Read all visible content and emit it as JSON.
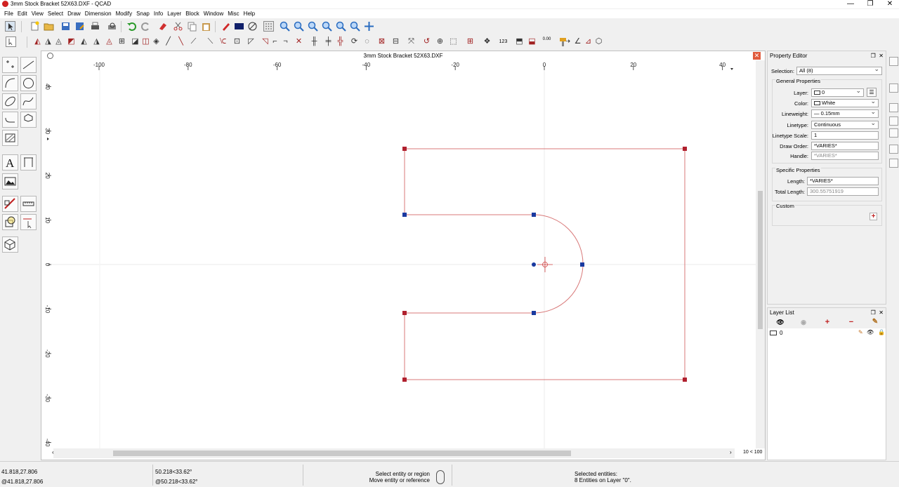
{
  "window": {
    "title": "3mm Stock Bracket 52X63.DXF - QCAD",
    "minimize": "—",
    "maximize": "❐",
    "close": "✕"
  },
  "menu": [
    "File",
    "Edit",
    "View",
    "Select",
    "Draw",
    "Dimension",
    "Modify",
    "Snap",
    "Info",
    "Layer",
    "Block",
    "Window",
    "Misc",
    "Help"
  ],
  "toolbar": {
    "number_label": "123",
    "decimal_label": "0.00"
  },
  "document": {
    "title": "3mm Stock Bracket 52X63.DXF",
    "close_icon": "close-icon",
    "zoom_info": "10 < 100",
    "ruler_x_ticks": [
      "-100",
      "-80",
      "-60",
      "-40",
      "-20",
      "0",
      "20",
      "40"
    ],
    "ruler_y_ticks": [
      "40",
      "30",
      "20",
      "10",
      "0",
      "-10",
      "-20",
      "-30",
      "-40"
    ],
    "colors": {
      "entity": "#d87878",
      "selected_handle": "#b0202e",
      "endpoint_handle": "#1a3aa0",
      "grid_axis": "#e8e8e8"
    }
  },
  "property_editor": {
    "title": "Property Editor",
    "selection_label": "Selection:",
    "selection_value": "All (8)",
    "general_title": "General Properties",
    "layer_label": "Layer:",
    "layer_value": "0",
    "color_label": "Color:",
    "color_value": "White",
    "lineweight_label": "Lineweight:",
    "lineweight_value": "— 0.15mm",
    "linetype_label": "Linetype:",
    "linetype_value": "Continuous",
    "linetype_scale_label": "Linetype Scale:",
    "linetype_scale_value": "1",
    "draw_order_label": "Draw Order:",
    "draw_order_value": "*VARIES*",
    "handle_label": "Handle:",
    "handle_value": "*VARIES*",
    "specific_title": "Specific Properties",
    "length_label": "Length:",
    "length_value": "*VARIES*",
    "total_length_label": "Total Length:",
    "total_length_value": "300.55751919",
    "custom_title": "Custom",
    "add_custom": "+"
  },
  "layer_list": {
    "title": "Layer List",
    "show_all": "👁",
    "hide_all": "◉",
    "add": "+",
    "remove": "−",
    "edit": "✎",
    "layers": [
      {
        "name": "0"
      }
    ]
  },
  "status": {
    "coords_abs": "41.818,27.806",
    "coords_rel": "@41.818,27.806",
    "polar_abs": "50.218<33.62°",
    "polar_rel": "@50.218<33.62°",
    "hint1": "Select entity or region",
    "hint2": "Move entity or reference",
    "selected_title": "Selected entities:",
    "selected_info": "8 Entities on Layer \"0\"."
  }
}
